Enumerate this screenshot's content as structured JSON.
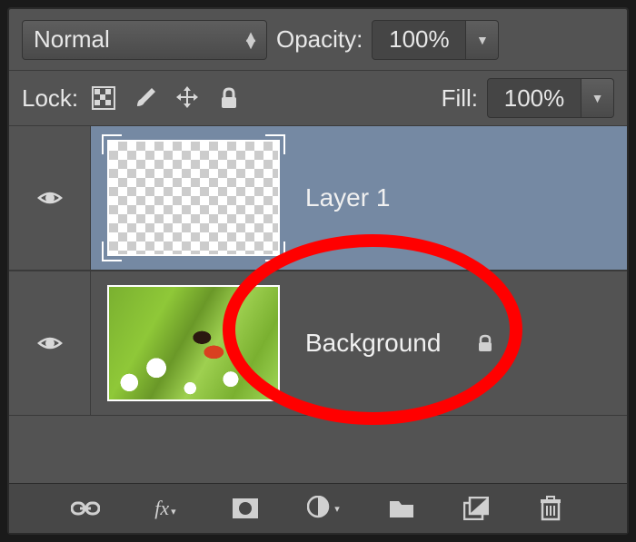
{
  "top": {
    "blend_mode": "Normal",
    "opacity_label": "Opacity:",
    "opacity_value": "100%"
  },
  "lock": {
    "label": "Lock:",
    "fill_label": "Fill:",
    "fill_value": "100%"
  },
  "layers": [
    {
      "name": "Layer 1",
      "selected": true,
      "locked": false,
      "visible": true,
      "thumb": "transparent"
    },
    {
      "name": "Background",
      "selected": false,
      "locked": true,
      "visible": true,
      "thumb": "flower"
    }
  ],
  "icons": {
    "transparency": "lock-transparency-icon",
    "brush": "lock-brush-icon",
    "move": "lock-position-icon",
    "lock": "lock-all-icon",
    "link": "link-layers-icon",
    "fx": "layer-fx-icon",
    "mask": "layer-mask-icon",
    "adjust": "adjustment-layer-icon",
    "group": "new-group-icon",
    "new": "new-layer-icon",
    "trash": "delete-layer-icon"
  }
}
